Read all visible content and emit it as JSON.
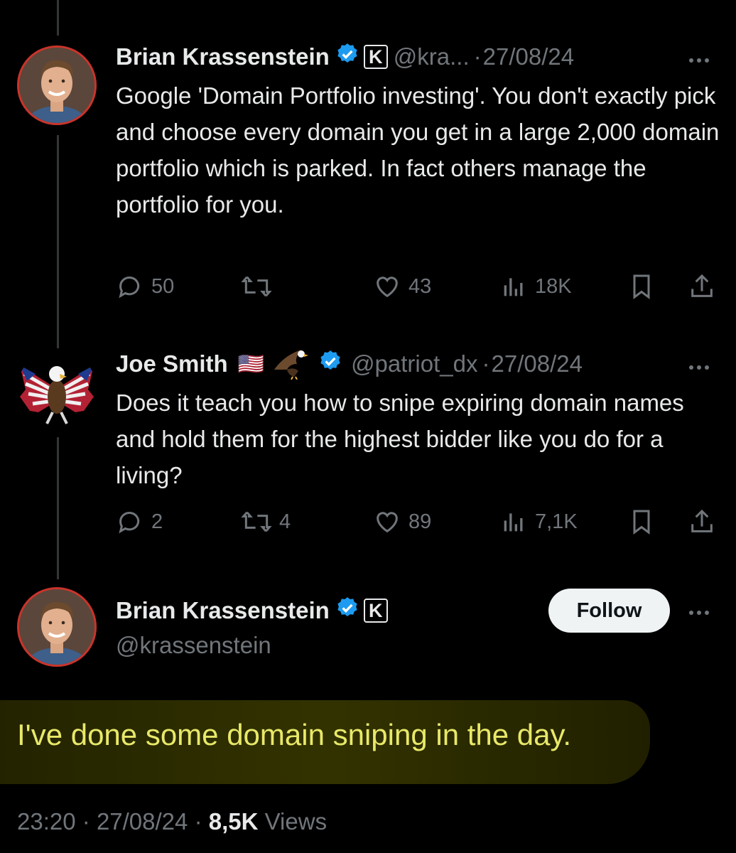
{
  "tweets": [
    {
      "name": "Brian Krassenstein",
      "badge_letter": "K",
      "handle": "@kra...",
      "date": "27/08/24",
      "text": "Google 'Domain Portfolio investing'.  You don't exactly pick and choose every domain you get in a large 2,000 domain portfolio which is parked.  In fact others manage the portfolio for you.",
      "replies": "50",
      "reposts": "",
      "likes": "43",
      "views": "18K"
    },
    {
      "name": "Joe Smith",
      "emoji": "🇺🇸",
      "handle": "@patriot_dx",
      "date": "27/08/24",
      "text": "Does it teach you how to snipe expiring domain names and hold them for the highest bidder like you do for a living?",
      "replies": "2",
      "reposts": "4",
      "likes": "89",
      "views": "7,1K"
    }
  ],
  "main_tweet": {
    "name": "Brian Krassenstein",
    "badge_letter": "K",
    "handle": "@krassenstein",
    "follow_label": "Follow",
    "text": "I've done some domain sniping in the day.",
    "time": "23:20",
    "date": "27/08/24",
    "views_count": "8,5K",
    "views_label": "Views"
  },
  "colors": {
    "background": "#000000",
    "text": "#e7e9ea",
    "muted": "#71767b",
    "verified": "#1d9bf0",
    "highlight_text": "#e8e86a"
  }
}
